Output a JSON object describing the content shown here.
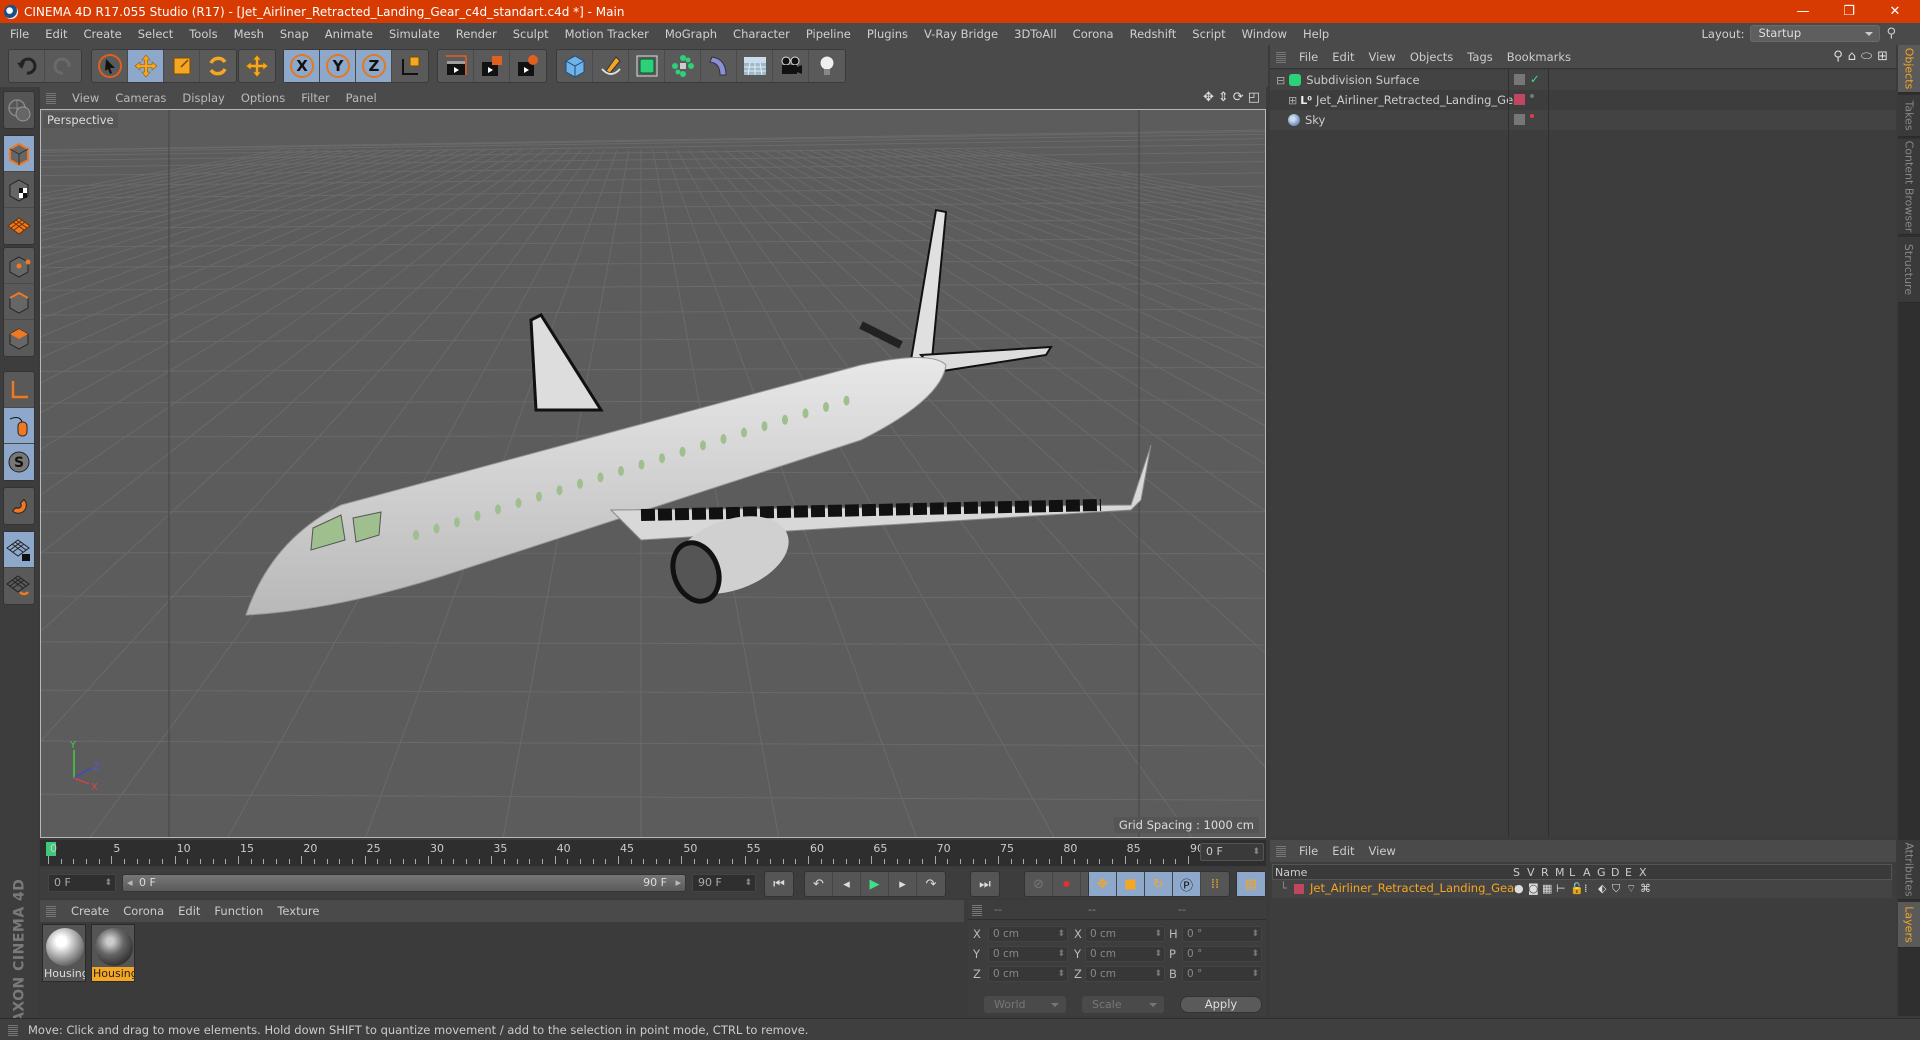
{
  "window": {
    "title": "CINEMA 4D R17.055 Studio (R17) - [Jet_Airliner_Retracted_Landing_Gear_c4d_standart.c4d *] - Main",
    "controls": {
      "minimize": "—",
      "restore": "❐",
      "close": "✕"
    }
  },
  "menubar": {
    "items": [
      "File",
      "Edit",
      "Create",
      "Select",
      "Tools",
      "Mesh",
      "Snap",
      "Animate",
      "Simulate",
      "Render",
      "Sculpt",
      "Motion Tracker",
      "MoGraph",
      "Character",
      "Pipeline",
      "Plugins",
      "V-Ray Bridge",
      "3DToAll",
      "Corona",
      "Redshift",
      "Script",
      "Window",
      "Help"
    ],
    "layout_label": "Layout:",
    "layout_value": "Startup"
  },
  "toolbar": {
    "groups": [
      {
        "name": "history",
        "buttons": [
          {
            "icon": "undo-icon"
          },
          {
            "icon": "redo-icon"
          }
        ]
      },
      {
        "name": "tools",
        "buttons": [
          {
            "icon": "select-arrow-icon"
          },
          {
            "icon": "move-icon",
            "active": true
          },
          {
            "icon": "scale-icon"
          },
          {
            "icon": "rotate-icon"
          }
        ]
      },
      {
        "name": "last-tool",
        "buttons": [
          {
            "icon": "move-icon"
          }
        ]
      },
      {
        "name": "axes",
        "buttons": [
          {
            "icon": "x-axis-icon",
            "label": "X",
            "active": true
          },
          {
            "icon": "y-axis-icon",
            "label": "Y",
            "active": true
          },
          {
            "icon": "z-axis-icon",
            "label": "Z",
            "active": true
          },
          {
            "icon": "coordinate-system-icon"
          }
        ]
      },
      {
        "name": "render",
        "buttons": [
          {
            "icon": "render-view-icon"
          },
          {
            "icon": "render-picture-viewer-icon"
          },
          {
            "icon": "render-settings-icon"
          }
        ]
      },
      {
        "name": "create",
        "buttons": [
          {
            "icon": "cube-icon"
          },
          {
            "icon": "pen-spline-icon"
          },
          {
            "icon": "subdivision-icon"
          },
          {
            "icon": "cloner-icon"
          },
          {
            "icon": "deformer-icon"
          },
          {
            "icon": "floor-icon"
          },
          {
            "icon": "camera-icon"
          },
          {
            "icon": "light-icon"
          }
        ]
      }
    ]
  },
  "lefttools": [
    {
      "icon": "make-editable-icon"
    },
    {
      "icon": "model-mode-icon",
      "active": true
    },
    {
      "icon": "texture-mode-icon"
    },
    {
      "icon": "workplane-mode-icon"
    },
    {
      "icon": "points-mode-icon"
    },
    {
      "icon": "edges-mode-icon"
    },
    {
      "icon": "polygons-mode-icon"
    },
    {
      "icon": "axis-mode-icon"
    },
    {
      "icon": "tweak-mode-icon",
      "active": true
    },
    {
      "icon": "solo-icon",
      "active": true
    },
    {
      "icon": "snap-magnet-icon"
    },
    {
      "icon": "lock-workplane-icon",
      "active": true
    },
    {
      "icon": "planar-workplane-icon"
    }
  ],
  "viewport": {
    "menu": [
      "View",
      "Cameras",
      "Display",
      "Options",
      "Filter",
      "Panel"
    ],
    "camera_label": "Perspective",
    "grid_spacing": "Grid Spacing : 1000 cm",
    "axis": {
      "x": "X",
      "y": "Y",
      "z": "Z"
    },
    "nav_icons": [
      "move-view-icon",
      "zoom-view-icon",
      "rotate-view-icon",
      "toggle-layout-icon"
    ]
  },
  "timeline": {
    "start": 0,
    "end": 90,
    "major_step": 5,
    "current": 0,
    "current_label": "0 F"
  },
  "transport": {
    "start_field": "0 F",
    "range_start": "0 F",
    "range_end": "90 F",
    "end_field": "90 F",
    "buttons": [
      "go-to-start-icon",
      "prev-key-icon",
      "prev-frame-icon",
      "play-icon",
      "next-frame-icon",
      "next-key-icon",
      "go-to-end-icon"
    ],
    "record": [
      "motion-path-icon",
      "record-keys-icon",
      "autokey-icon"
    ],
    "keymode": [
      "key-position-icon",
      "key-scale-icon",
      "key-rotation-icon",
      "key-param-icon",
      "key-pla-icon"
    ],
    "timeline_btn": "timeline-window-icon"
  },
  "materials": {
    "menu": [
      "Create",
      "Corona",
      "Edit",
      "Function",
      "Texture"
    ],
    "items": [
      {
        "name": "Housing",
        "selected": false
      },
      {
        "name": "Housing",
        "selected": true
      }
    ]
  },
  "brand": "MAXON CINEMA 4D",
  "coordinates": {
    "headers": [
      "--",
      "--",
      "--"
    ],
    "rows": [
      {
        "l1": "X",
        "v1": "0 cm",
        "l2": "X",
        "v2": "0 cm",
        "l3": "H",
        "v3": "0 °"
      },
      {
        "l1": "Y",
        "v1": "0 cm",
        "l2": "Y",
        "v2": "0 cm",
        "l3": "P",
        "v3": "0 °"
      },
      {
        "l1": "Z",
        "v1": "0 cm",
        "l2": "Z",
        "v2": "0 cm",
        "l3": "B",
        "v3": "0 °"
      }
    ],
    "space": "World",
    "mode": "Scale",
    "apply": "Apply"
  },
  "objects": {
    "menu": [
      "File",
      "Edit",
      "View",
      "Objects",
      "Tags",
      "Bookmarks"
    ],
    "tree": [
      {
        "name": "Subdivision Surface",
        "icon": "subdivision-surface-icon",
        "depth": 0,
        "expander": "⊟",
        "check": "✓"
      },
      {
        "name": "Jet_Airliner_Retracted_Landing_Gear",
        "icon": "null-object-icon",
        "depth": 1,
        "expander": "⊞",
        "layer_color": "#c0475f"
      },
      {
        "name": "Sky",
        "icon": "sky-icon",
        "depth": 0,
        "expander": ""
      }
    ]
  },
  "layers": {
    "menu": [
      "File",
      "Edit",
      "View"
    ],
    "columns": [
      "Name",
      "S",
      "V",
      "R",
      "M",
      "L",
      "A",
      "G",
      "D",
      "E",
      "X"
    ],
    "rows": [
      {
        "name": "Jet_Airliner_Retracted_Landing_Gear",
        "color": "#c0475f"
      }
    ]
  },
  "righttabs": {
    "top": [
      {
        "label": "Objects",
        "active": true
      },
      {
        "label": "Takes"
      },
      {
        "label": "Content Browser"
      },
      {
        "label": "Structure"
      }
    ],
    "bottom": [
      {
        "label": "Attributes"
      },
      {
        "label": "Layers",
        "active": true
      }
    ]
  },
  "status": "Move: Click and drag to move elements. Hold down SHIFT to quantize movement / add to the selection in point mode, CTRL to remove.",
  "colors": {
    "accent": "#f5a623",
    "titlebar": "#d83b01",
    "active_button": "#8ea8cc",
    "layer": "#c0475f"
  }
}
